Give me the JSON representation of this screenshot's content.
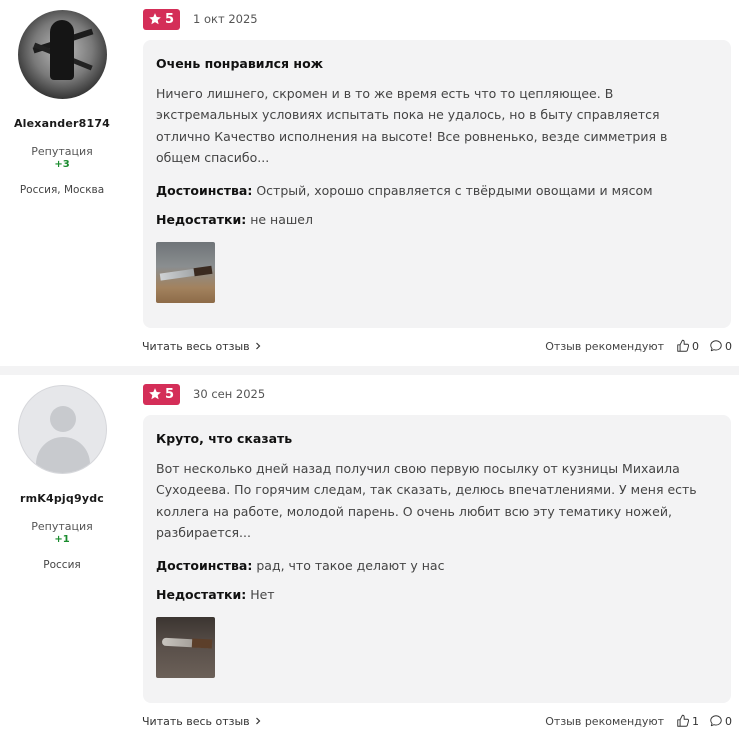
{
  "reviews": [
    {
      "author": {
        "name": "Alexander8174",
        "reputation_label": "Репутация",
        "reputation_value": "+3",
        "location": "Россия, Москва"
      },
      "rating": "5",
      "date": "1 окт 2025",
      "title": "Очень понравился нож",
      "text": "Ничего лишнего, скромен и в то же время есть что то цепляющее. В экстремальных условиях испытать пока не удалось, но в быту справляется отлично Качество исполнения на высоте! Все ровненько, везде симметрия в общем спасибо...",
      "pros_label": "Достоинства:",
      "pros": "Острый, хорошо справляется с твёрдыми овощами и мясом",
      "cons_label": "Недостатки:",
      "cons": "не нашел",
      "read_more": "Читать весь отзыв",
      "recommend_label": "Отзыв рекомендуют",
      "likes": "0",
      "comments": "0"
    },
    {
      "author": {
        "name": "rmK4pjq9ydc",
        "reputation_label": "Репутация",
        "reputation_value": "+1",
        "location": "Россия"
      },
      "rating": "5",
      "date": "30 сен 2025",
      "title": "Круто, что сказать",
      "text": "Вот несколько дней назад получил свою первую посылку от кузницы Михаила Суходеева. По горячим следам, так сказать, делюсь впечатлениями. У меня есть коллега на работе, молодой парень. О очень любит всю эту тематику ножей, разбирается...",
      "pros_label": "Достоинства:",
      "pros": "рад, что такое делают у нас",
      "cons_label": "Недостатки:",
      "cons": "Нет",
      "read_more": "Читать весь отзыв",
      "recommend_label": "Отзыв рекомендуют",
      "likes": "1",
      "comments": "0"
    }
  ],
  "colors": {
    "rating_badge": "#d42e58",
    "card_bg": "#f3f3f4",
    "reputation": "#1a8c2e"
  },
  "icons": {
    "rating": "star-icon",
    "read_more": "chevron-right-icon",
    "like": "thumbs-up-icon",
    "comment": "comment-icon"
  }
}
